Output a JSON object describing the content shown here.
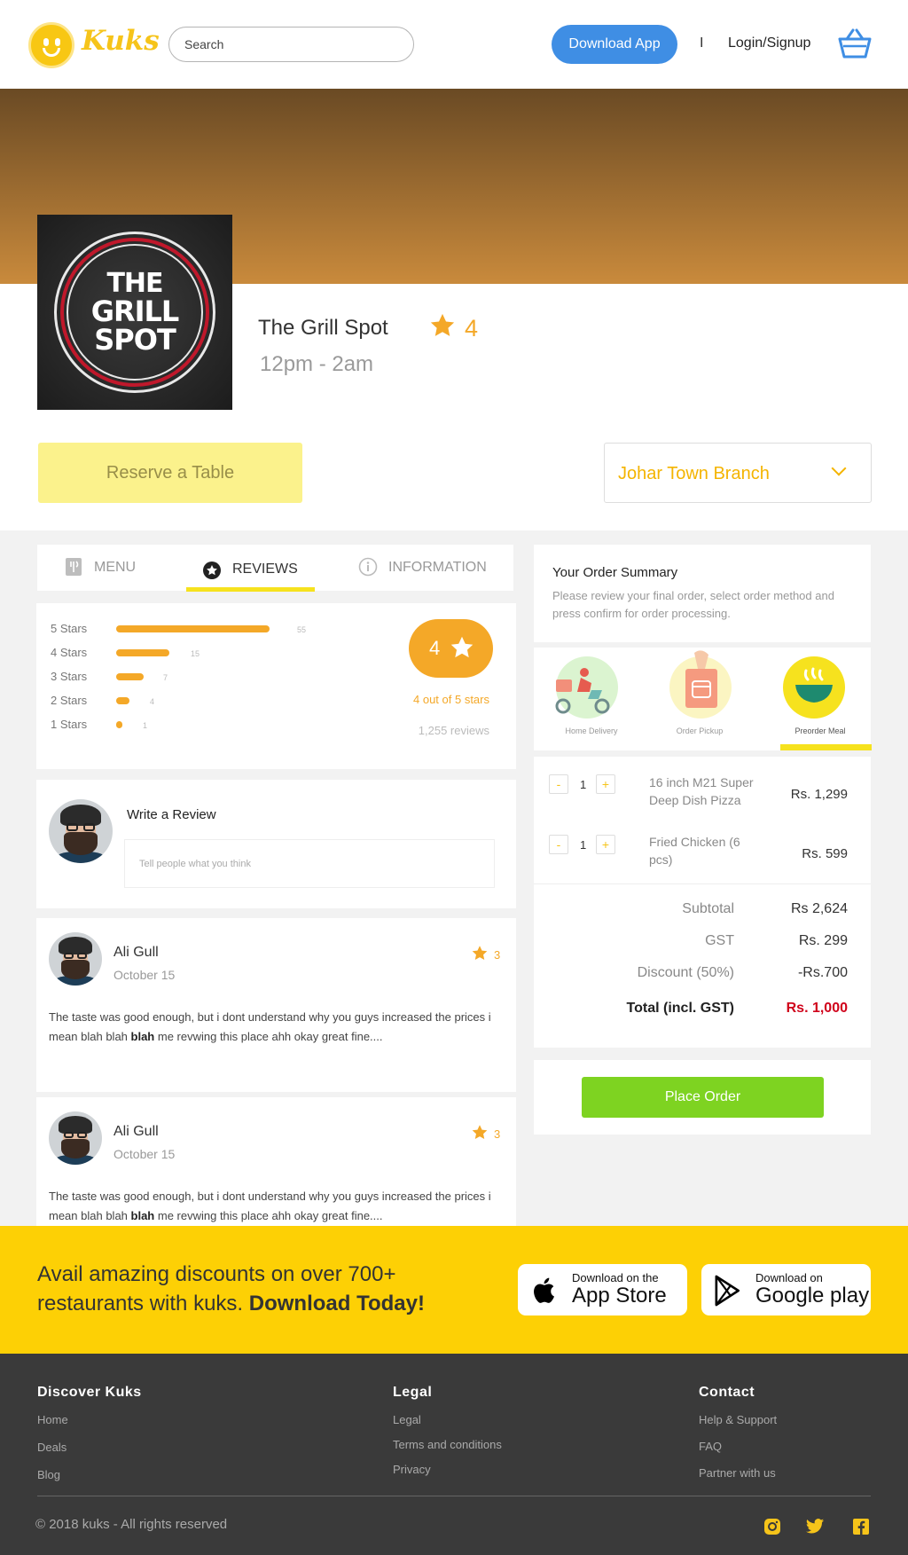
{
  "header": {
    "logo_text": "Kuks",
    "search_placeholder": "Search",
    "download_label": "Download App",
    "separator": "I",
    "login_label": "Login/Signup"
  },
  "restaurant": {
    "logo_line1": "THE",
    "logo_line2": "GRILL",
    "logo_line3": "SPOT",
    "name": "The Grill Spot",
    "rating": "4",
    "hours": "12pm - 2am",
    "reserve_label": "Reserve a Table",
    "branch": "Johar Town Branch"
  },
  "tabs": [
    {
      "label": "MENU"
    },
    {
      "label": "REVIEWS"
    },
    {
      "label": "INFORMATION"
    }
  ],
  "rating_summary": {
    "rows": [
      {
        "label": "5 Stars",
        "count": "55",
        "fraction": 1.0
      },
      {
        "label": "4 Stars",
        "count": "15",
        "fraction": 0.35
      },
      {
        "label": "3 Stars",
        "count": "7",
        "fraction": 0.18
      },
      {
        "label": "2 Stars",
        "count": "4",
        "fraction": 0.09
      },
      {
        "label": "1 Stars",
        "count": "1",
        "fraction": 0.04
      }
    ],
    "score": "4",
    "out_of": "4 out of 5 stars",
    "total_reviews": "1,255 reviews",
    "accent_color": "#f4a828"
  },
  "write_review": {
    "title": "Write a  Review",
    "placeholder": "Tell people what you think"
  },
  "reviews": [
    {
      "name": "Ali Gull",
      "date": "October 15",
      "rating": "3",
      "text_before": "The taste was good enough, but i dont understand why you guys increased the prices i mean blah blah ",
      "text_bold": "blah",
      "text_after": " me revwing this place ahh okay great fine...."
    },
    {
      "name": "Ali Gull",
      "date": "October 15",
      "rating": "3",
      "text_before": "The taste was good enough, but i dont understand why you guys increased the prices i mean blah blah ",
      "text_bold": "blah",
      "text_after": " me revwing this place ahh okay great fine...."
    }
  ],
  "order_summary": {
    "title": "Your Order Summary",
    "subtitle": "Please review your final order, select order method and press confirm for order processing.",
    "methods": [
      {
        "label": "Home Delivery",
        "icon": "scooter-icon"
      },
      {
        "label": "Order Pickup",
        "icon": "bag-icon"
      },
      {
        "label": "Preorder Meal",
        "icon": "bowl-icon",
        "selected": true
      }
    ],
    "items": [
      {
        "qty": "1",
        "name": "16 inch M21 Super Deep Dish Pizza",
        "price": "Rs. 1,299"
      },
      {
        "qty": "1",
        "name": "Fried Chicken (6 pcs)",
        "price": "Rs. 599"
      }
    ],
    "minus": "-",
    "plus": "+",
    "subtotal_label": "Subtotal",
    "subtotal": "Rs 2,624",
    "gst_label": "GST",
    "gst": "Rs. 299",
    "discount_label": "Discount (50%)",
    "discount": "-Rs.700",
    "total_label": "Total (incl. GST)",
    "total": "Rs. 1,000",
    "place_order": "Place Order"
  },
  "promo": {
    "text": "Avail amazing discounts on over 700+ restaurants with kuks. ",
    "text_bold": "Download Today!",
    "app_store_line1": "Download on the",
    "app_store_line2": "App Store",
    "google_line1": "Download on",
    "google_line2": "Google play"
  },
  "footer": {
    "discover_title": "Discover Kuks",
    "discover_links": [
      "Home",
      "Deals",
      "Blog"
    ],
    "legal_title": "Legal",
    "legal_links": [
      "Legal",
      "Terms and conditions",
      "Privacy"
    ],
    "contact_title": "Contact",
    "contact_links": [
      "Help & Support",
      "FAQ",
      "Partner with us"
    ],
    "copyright": "© 2018 kuks - All rights reserved"
  }
}
